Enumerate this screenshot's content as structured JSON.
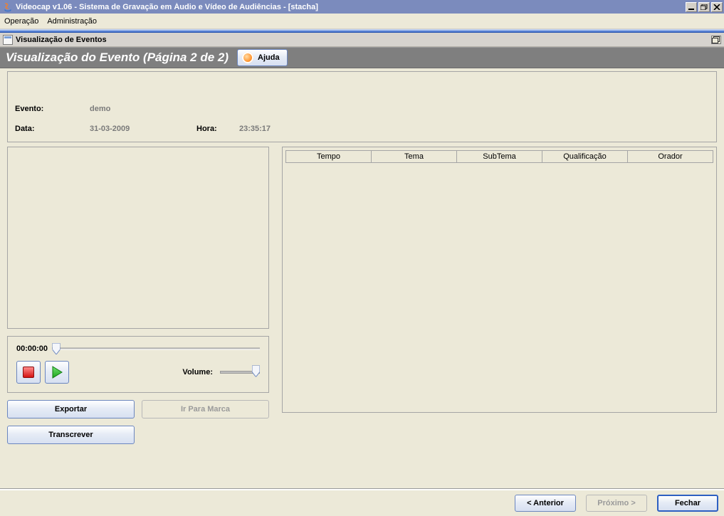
{
  "window": {
    "title": "Videocap v1.06 - Sistema de Gravação em Áudio e Vídeo de Audiências - [stacha]"
  },
  "menubar": {
    "items": [
      "Operação",
      "Administração"
    ]
  },
  "mdi": {
    "title": "Visualização de Eventos"
  },
  "page": {
    "title": "Visualização do Evento (Página 2 de 2)",
    "help_label": "Ajuda"
  },
  "fields": {
    "evento_label": "Evento:",
    "evento_value": "demo",
    "data_label": "Data:",
    "data_value": "31-03-2009",
    "hora_label": "Hora:",
    "hora_value": "23:35:17"
  },
  "playback": {
    "time": "00:00:00",
    "volume_label": "Volume:"
  },
  "actions": {
    "exportar": "Exportar",
    "ir_para_marca": "Ir Para Marca",
    "transcrever": "Transcrever"
  },
  "table": {
    "headers": [
      "Tempo",
      "Tema",
      "SubTema",
      "Qualificação",
      "Orador"
    ]
  },
  "footer": {
    "anterior": "< Anterior",
    "proximo": "Próximo >",
    "fechar": "Fechar"
  }
}
